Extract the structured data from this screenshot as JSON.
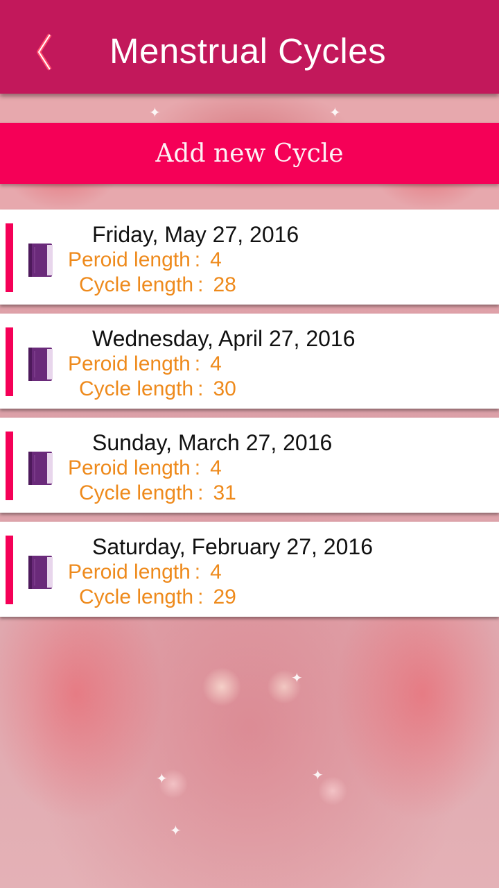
{
  "header": {
    "title": "Menstrual Cycles",
    "back_icon": "chevron-left-icon"
  },
  "actions": {
    "add_label": "Add new Cycle"
  },
  "labels": {
    "period": "Peroid length",
    "cycle": "Cycle length",
    "separator": ":"
  },
  "colors": {
    "appbar": "#c2185b",
    "accent": "#f50057",
    "value_text": "#ee8a1c"
  },
  "cycles": [
    {
      "date": "Friday, May 27, 2016",
      "period_length": "4",
      "cycle_length": "28"
    },
    {
      "date": "Wednesday, April 27, 2016",
      "period_length": "4",
      "cycle_length": "30"
    },
    {
      "date": "Sunday, March 27, 2016",
      "period_length": "4",
      "cycle_length": "31"
    },
    {
      "date": "Saturday, February 27, 2016",
      "period_length": "4",
      "cycle_length": "29"
    }
  ]
}
